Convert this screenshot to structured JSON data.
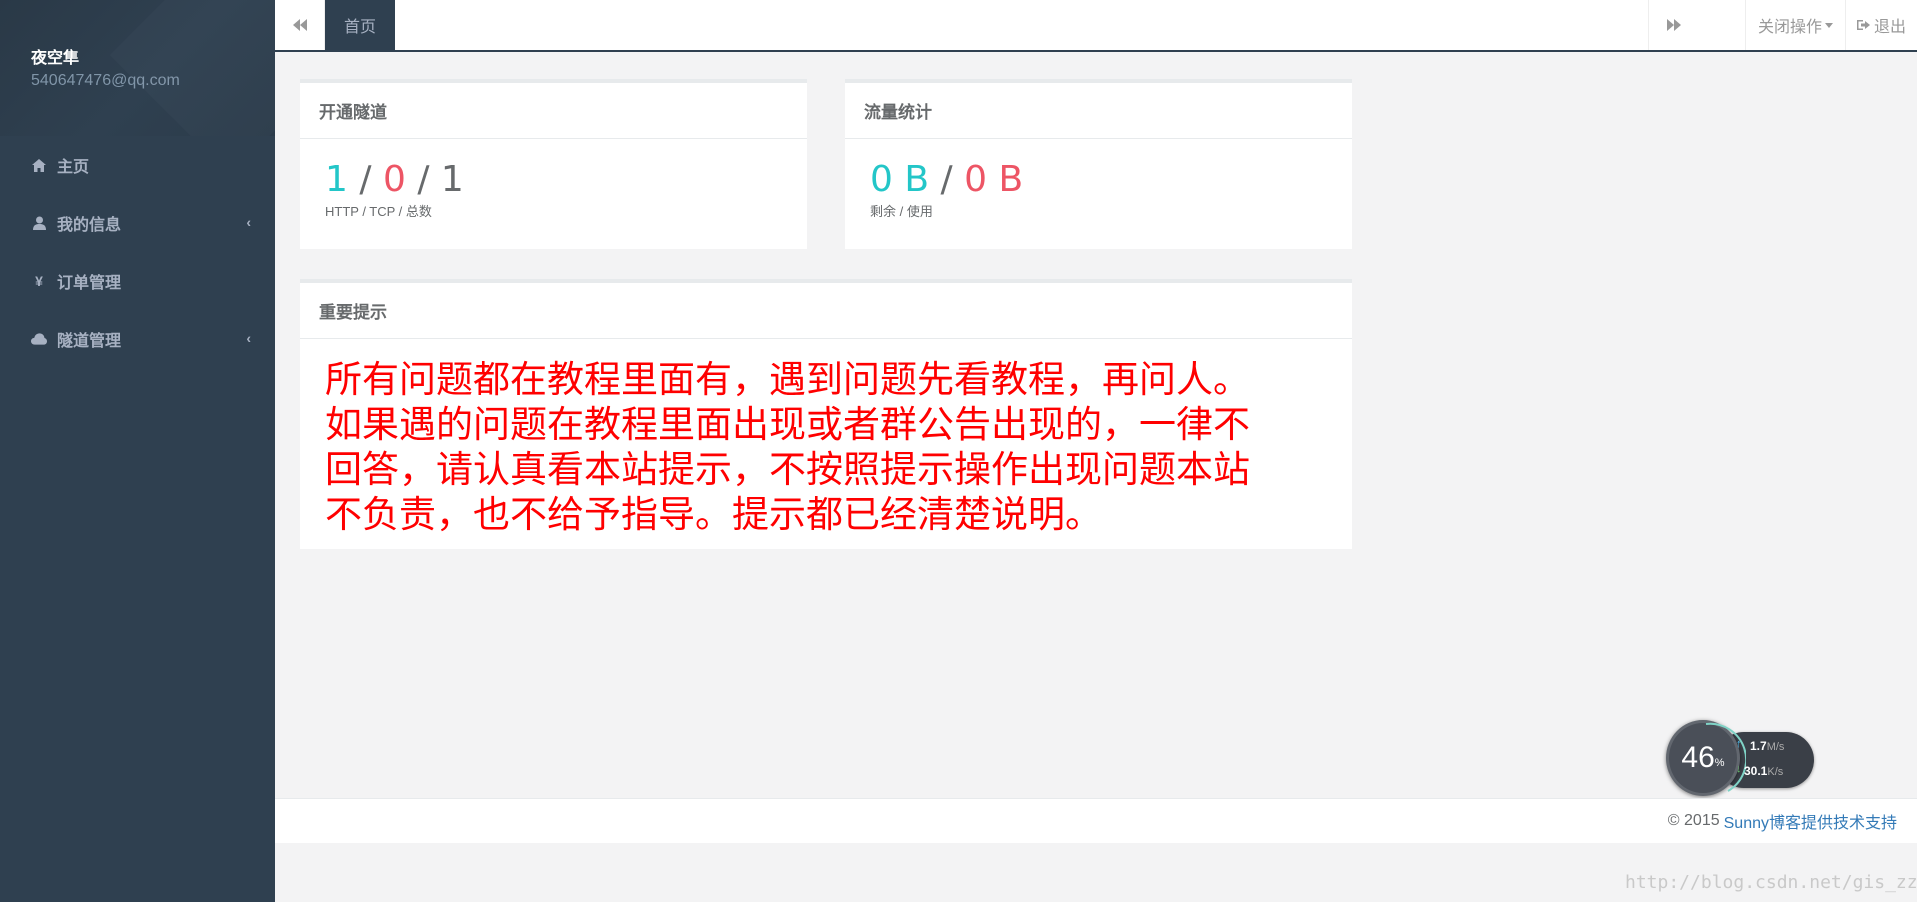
{
  "user": {
    "name": "夜空隼",
    "email": "540647476@qq.com"
  },
  "sidebar": {
    "items": [
      {
        "label": "主页",
        "icon": "home-icon",
        "has_arrow": false
      },
      {
        "label": "我的信息",
        "icon": "user-icon",
        "has_arrow": true,
        "arrow": "‹"
      },
      {
        "label": "订单管理",
        "icon": "yen-icon",
        "has_arrow": false,
        "glyph": "¥"
      },
      {
        "label": "隧道管理",
        "icon": "cloud-icon",
        "has_arrow": true,
        "arrow": "‹"
      }
    ]
  },
  "topbar": {
    "tab_label": "首页",
    "close_label": "关闭操作",
    "logout_label": "退出"
  },
  "tunnels": {
    "title": "开通隧道",
    "http": "1",
    "tcp": "0",
    "total": "1",
    "sep": "/",
    "caption": "HTTP / TCP / 总数"
  },
  "traffic": {
    "title": "流量统计",
    "remaining": "0 B",
    "used": "0 B",
    "sep": "/",
    "caption": "剩余 / 使用"
  },
  "notice": {
    "title": "重要提示",
    "text": "所有问题都在教程里面有，遇到问题先看教程，再问人。如果遇的问题在教程里面出现或者群公告出现的，一律不回答，请认真看本站提示，不按照提示操作出现问题本站不负责，也不给予指导。提示都已经清楚说明。"
  },
  "footer": {
    "copyright": "© 2015",
    "link_text": "Sunny博客提供技术支持"
  },
  "speed_widget": {
    "percent": "46",
    "percent_unit": "%",
    "upload_value": "1.7",
    "upload_unit": "M/s",
    "download_value": "30.1",
    "download_unit": "K/s",
    "up_arrow": "↑",
    "down_arrow": "↓"
  },
  "watermark": "http://blog.csdn.net/gis_zzu",
  "colors": {
    "sidebar_bg": "#2f4050",
    "accent_teal": "#23c6c8",
    "accent_red": "#ed5565",
    "notice_red": "#ff0000",
    "link_blue": "#337ab7"
  }
}
